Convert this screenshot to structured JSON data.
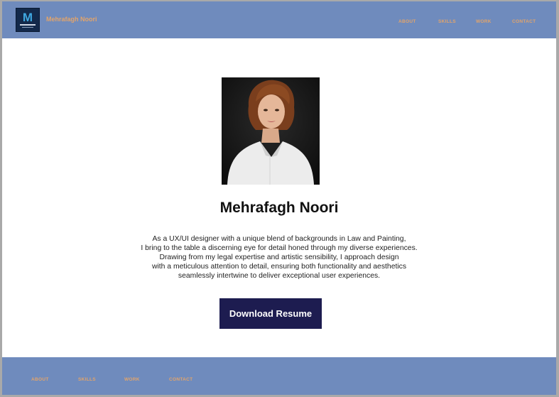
{
  "header": {
    "logo_letter": "M",
    "brand_name": "Mehrafagh Noori",
    "nav": [
      "ABOUT",
      "SKILLS",
      "WORK",
      "CONTACT"
    ]
  },
  "hero": {
    "photo_icon": "portrait-photo",
    "name": "Mehrafagh Noori",
    "bio_lines": [
      "As a UX/UI designer with a unique blend of backgrounds in Law and Painting,",
      "I bring to the table a discerning eye for detail honed through my diverse experiences.",
      "Drawing from my legal expertise and artistic sensibility, I approach design",
      "with a meticulous attention to detail, ensuring both functionality and aesthetics",
      "seamlessly intertwine to deliver exceptional user experiences."
    ],
    "download_label": "Download Resume"
  },
  "footer": {
    "nav": [
      "ABOUT",
      "SKILLS",
      "WORK",
      "CONTACT"
    ]
  },
  "colors": {
    "bar": "#6f8bbd",
    "nav_text": "#e3a46a",
    "button": "#1d1c50"
  }
}
